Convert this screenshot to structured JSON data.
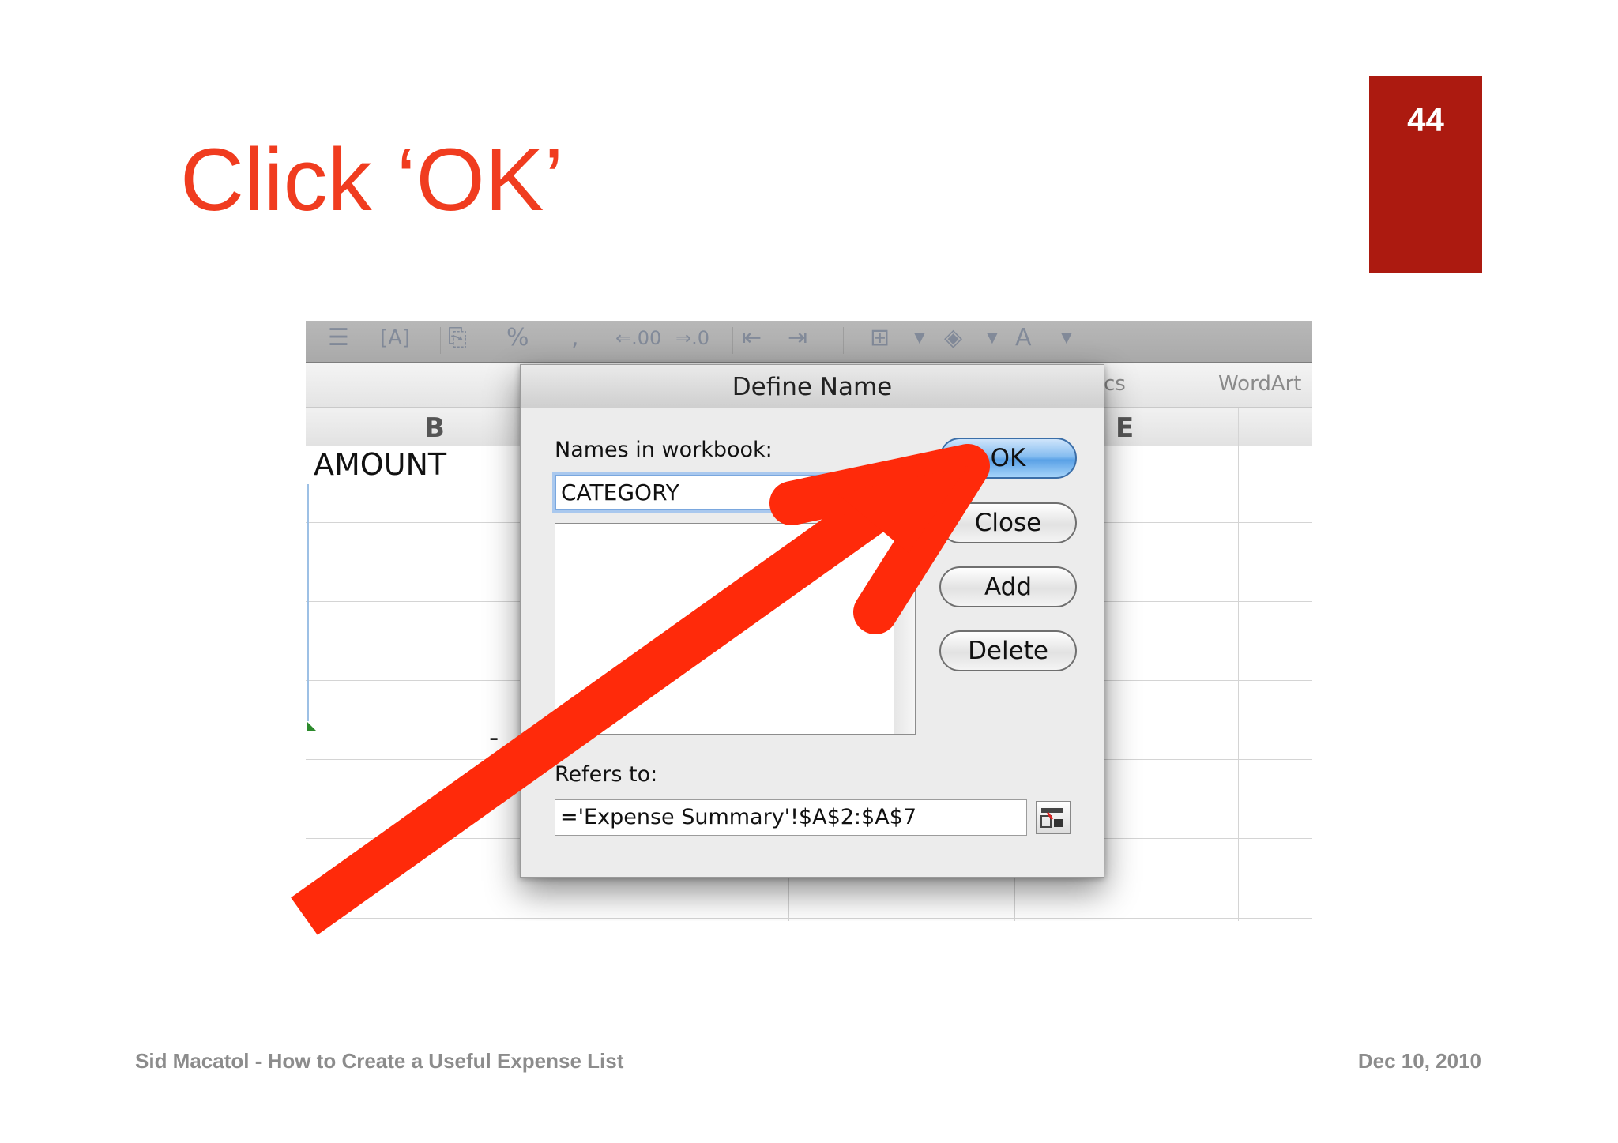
{
  "slide": {
    "title": "Click ‘OK’",
    "page_number": "44",
    "footer_left": "Sid Macatol - How to Create a Useful Expense List",
    "footer_right": "Dec 10, 2010"
  },
  "spreadsheet": {
    "ribbon_tabs": [
      "cs",
      "WordArt"
    ],
    "column_headers": [
      "B",
      "E"
    ],
    "cell_b1": "AMOUNT",
    "cell_dash": "-"
  },
  "dialog": {
    "title": "Define Name",
    "names_label": "Names in workbook:",
    "name_value": "CATEGORY",
    "refers_label": "Refers to:",
    "refers_value": "='Expense Summary'!$A$2:$A$7",
    "buttons": {
      "ok": "OK",
      "close": "Close",
      "add": "Add",
      "delete": "Delete"
    }
  },
  "colors": {
    "title_red": "#f03c1f",
    "badge_red": "#ac1a10",
    "arrow_red": "#ff2a0a",
    "ok_blue": "#5aa1e6"
  },
  "icons": [
    "text-size-icon",
    "format-icon",
    "percent-icon",
    "comma-icon",
    "decrease-decimal-icon",
    "increase-decimal-icon",
    "outdent-icon",
    "indent-icon",
    "borders-icon",
    "fill-color-icon",
    "font-color-icon",
    "red-arrow-annotation"
  ]
}
